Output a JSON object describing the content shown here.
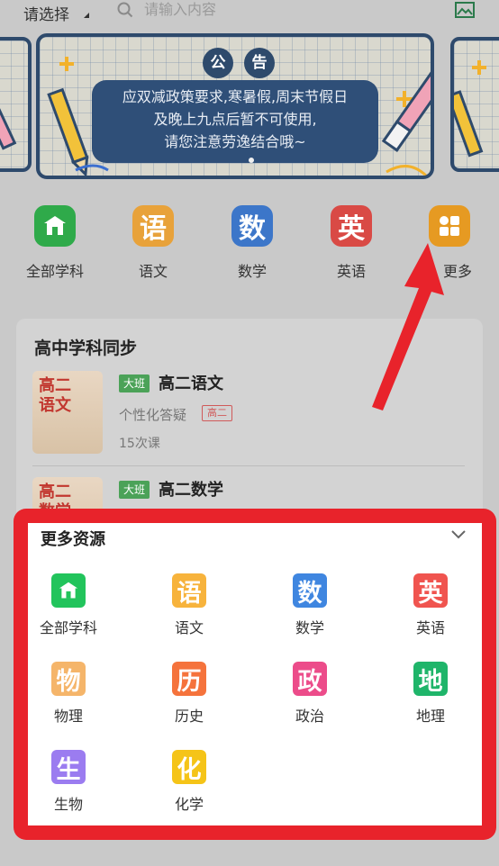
{
  "topbar": {
    "select_label": "请选择",
    "search_placeholder": "请输入内容"
  },
  "notice": {
    "title_chars": [
      "公",
      "告"
    ],
    "lines": [
      "应双减政策要求,寒暑假,周末节假日",
      "及晚上九点后暂不可使用,",
      "请您注意劳逸结合哦~"
    ]
  },
  "shortcuts": [
    {
      "label": "全部学科",
      "glyph": "",
      "color": "#2faa4a",
      "icon": "school-icon"
    },
    {
      "label": "语文",
      "glyph": "语",
      "color": "#e8a23a",
      "icon": "chinese-icon"
    },
    {
      "label": "数学",
      "glyph": "数",
      "color": "#3c76c9",
      "icon": "math-icon"
    },
    {
      "label": "英语",
      "glyph": "英",
      "color": "#d94a45",
      "icon": "english-icon"
    },
    {
      "label": "更多",
      "glyph": "",
      "color": "#e69a22",
      "icon": "more-grid-icon"
    }
  ],
  "course_section": {
    "title": "高中学科同步",
    "courses": [
      {
        "cover_text": "高二\n语文",
        "tag": "大班",
        "name": "高二语文",
        "subtitle": "个性化答疑",
        "grade": "高二",
        "count": "15次课"
      },
      {
        "cover_text": "高二\n数学",
        "tag": "大班",
        "name": "高二数学",
        "subtitle": "",
        "grade": "",
        "count": ""
      }
    ]
  },
  "more_resources": {
    "title": "更多资源",
    "items": [
      {
        "label": "全部学科",
        "glyph": "",
        "color": "#22c45c",
        "icon": "school-icon"
      },
      {
        "label": "语文",
        "glyph": "语",
        "color": "#f7b33c",
        "icon": "chinese-icon"
      },
      {
        "label": "数学",
        "glyph": "数",
        "color": "#3f86e0",
        "icon": "math-icon"
      },
      {
        "label": "英语",
        "glyph": "英",
        "color": "#f0544f",
        "icon": "english-icon"
      },
      {
        "label": "物理",
        "glyph": "物",
        "color": "#f5b56a",
        "icon": "physics-icon"
      },
      {
        "label": "历史",
        "glyph": "历",
        "color": "#f5733c",
        "icon": "history-icon"
      },
      {
        "label": "政治",
        "glyph": "政",
        "color": "#ec4c8a",
        "icon": "politics-icon"
      },
      {
        "label": "地理",
        "glyph": "地",
        "color": "#1fb56a",
        "icon": "geography-icon"
      },
      {
        "label": "生物",
        "glyph": "生",
        "color": "#9b7cf0",
        "icon": "biology-icon"
      },
      {
        "label": "化学",
        "glyph": "化",
        "color": "#f5c418",
        "icon": "chemistry-icon"
      }
    ]
  },
  "colors": {
    "annotation_red": "#e8232b",
    "banner_navy": "#2e4a6c"
  }
}
